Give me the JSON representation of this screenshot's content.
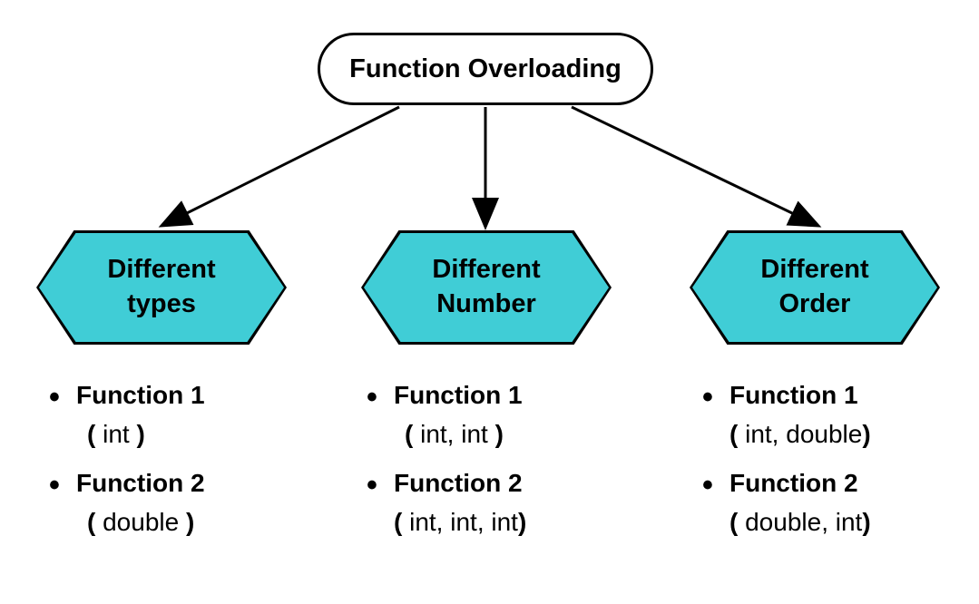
{
  "root": {
    "title": "Function Overloading"
  },
  "branches": [
    {
      "label_l1": "Different",
      "label_l2": "types",
      "items": [
        {
          "name": "Function 1",
          "sig_open": "( ",
          "params": "int",
          "sig_close": " )"
        },
        {
          "name": "Function 2",
          "sig_open": "( ",
          "params": "double",
          "sig_close": " )"
        }
      ]
    },
    {
      "label_l1": "Different",
      "label_l2": "Number",
      "items": [
        {
          "name": "Function 1",
          "sig_open": "( ",
          "params": "int, int",
          "sig_close": " )"
        },
        {
          "name": "Function 2",
          "sig_open": "( ",
          "params": "int, int,  int",
          "sig_close": ")"
        }
      ]
    },
    {
      "label_l1": "Different",
      "label_l2": "Order",
      "items": [
        {
          "name": "Function 1",
          "sig_open": "( ",
          "params": "int, double",
          "sig_close": ")"
        },
        {
          "name": "Function 2",
          "sig_open": "( ",
          "params": "double, int",
          "sig_close": ")"
        }
      ]
    }
  ]
}
